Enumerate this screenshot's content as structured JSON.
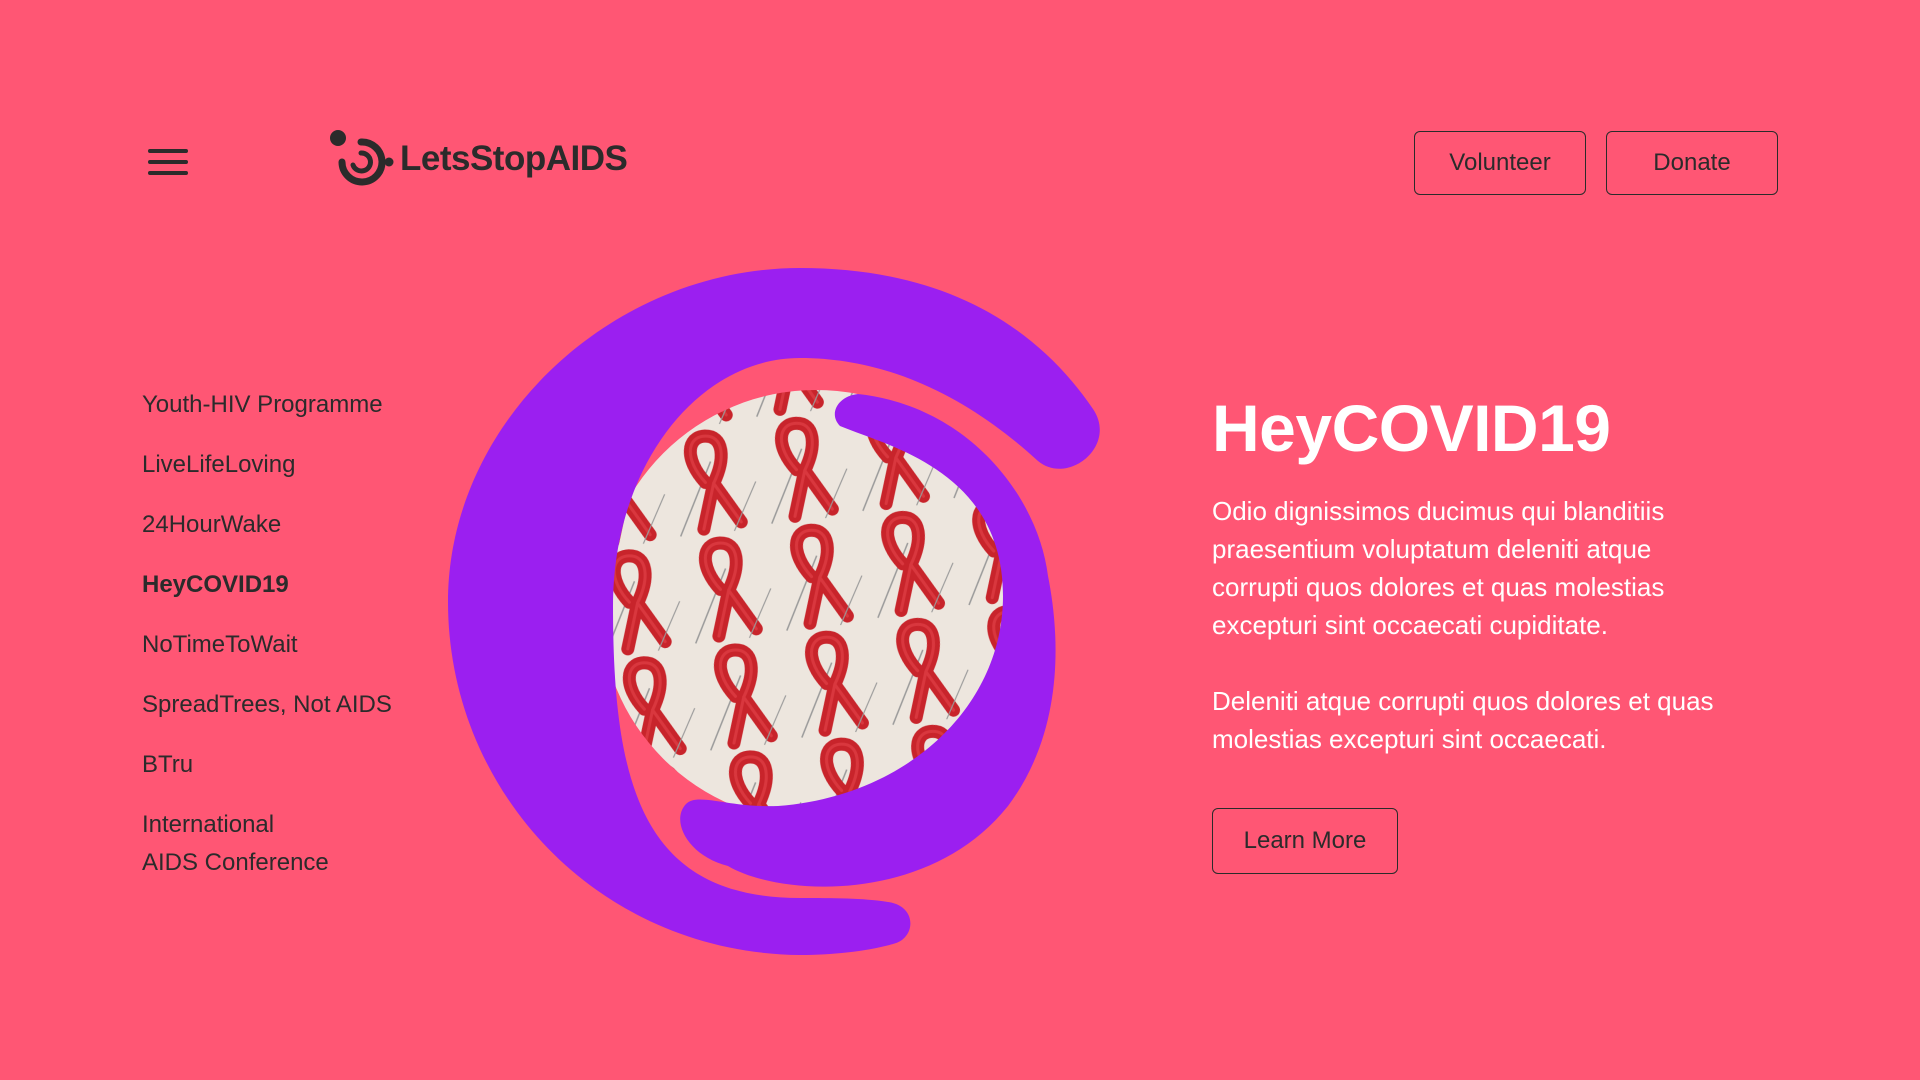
{
  "header": {
    "logo_text": "LetsStopAIDS",
    "volunteer_label": "Volunteer",
    "donate_label": "Donate"
  },
  "nav": {
    "items": [
      {
        "label": "Youth-HIV Programme"
      },
      {
        "label": "LiveLifeLoving"
      },
      {
        "label": "24HourWake"
      },
      {
        "label": "HeyCOVID19"
      },
      {
        "label": "NoTimeToWait"
      },
      {
        "label": "SpreadTrees, Not AIDS"
      },
      {
        "label": "BTru"
      },
      {
        "label_line1": "International",
        "label_line2": "AIDS Conference"
      }
    ],
    "active_label": "HeyCOVID19"
  },
  "main": {
    "title": "HeyCOVID19",
    "paragraph1": "Odio dignissimos ducimus qui blanditiis praesentium voluptatum deleniti atque corrupti quos dolores et quas molestias excepturi sint occaecati cupiditate.",
    "paragraph2": "Deleniti atque corrupti quos dolores et quas molestias excepturi sint occaecati.",
    "learn_more_label": "Learn More"
  },
  "colors": {
    "background": "#FF5674",
    "accent_purple": "#9B1FF0",
    "ribbon_red": "#C8242B",
    "text_dark": "#2b2b2b",
    "text_light": "#ffffff"
  },
  "icons": {
    "menu": "hamburger-menu-icon",
    "logo": "letsstopaids-logo-mark"
  }
}
